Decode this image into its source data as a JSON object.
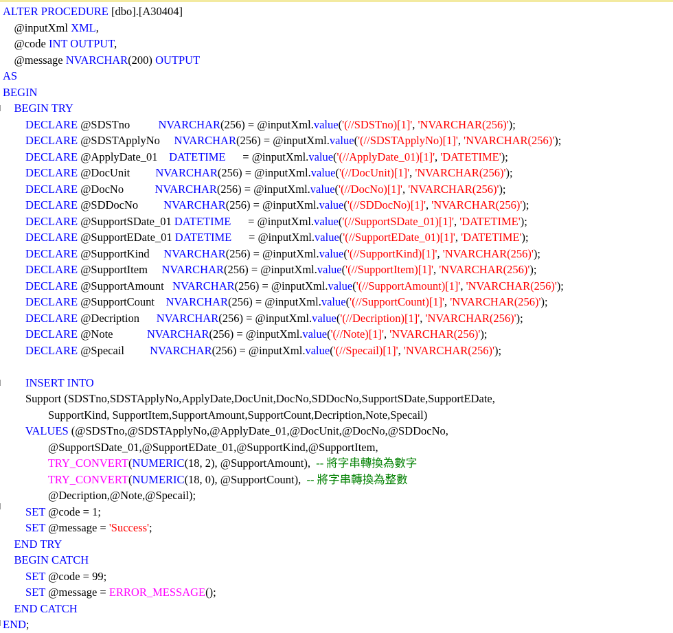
{
  "editor": {
    "lines": [
      [
        {
          "t": "ALTER PROCEDURE",
          "c": "kw"
        },
        {
          "t": " [dbo].[A30404]",
          "c": "pl"
        }
      ],
      [
        {
          "t": "    @inputXml ",
          "c": "pl"
        },
        {
          "t": "XML",
          "c": "kw"
        },
        {
          "t": ",",
          "c": "pl"
        }
      ],
      [
        {
          "t": "    @code ",
          "c": "pl"
        },
        {
          "t": "INT OUTPUT",
          "c": "kw"
        },
        {
          "t": ",",
          "c": "pl"
        }
      ],
      [
        {
          "t": "    @message ",
          "c": "pl"
        },
        {
          "t": "NVARCHAR",
          "c": "kw"
        },
        {
          "t": "(200) ",
          "c": "pl"
        },
        {
          "t": "OUTPUT",
          "c": "kw"
        }
      ],
      [
        {
          "t": "AS",
          "c": "kw"
        }
      ],
      [
        {
          "t": "BEGIN",
          "c": "kw"
        }
      ],
      [
        {
          "t": "    ",
          "c": "pl"
        },
        {
          "t": "BEGIN TRY",
          "c": "kw"
        }
      ],
      [
        {
          "t": "        ",
          "c": "pl"
        },
        {
          "t": "DECLARE",
          "c": "kw"
        },
        {
          "t": " @SDSTno          ",
          "c": "pl"
        },
        {
          "t": "NVARCHAR",
          "c": "kw"
        },
        {
          "t": "(256) = @inputXml.",
          "c": "pl"
        },
        {
          "t": "value",
          "c": "kw"
        },
        {
          "t": "(",
          "c": "pl"
        },
        {
          "t": "'(//SDSTno)[1]'",
          "c": "str"
        },
        {
          "t": ", ",
          "c": "pl"
        },
        {
          "t": "'NVARCHAR(256)'",
          "c": "str"
        },
        {
          "t": ");",
          "c": "pl"
        }
      ],
      [
        {
          "t": "        ",
          "c": "pl"
        },
        {
          "t": "DECLARE",
          "c": "kw"
        },
        {
          "t": " @SDSTApplyNo     ",
          "c": "pl"
        },
        {
          "t": "NVARCHAR",
          "c": "kw"
        },
        {
          "t": "(256) = @inputXml.",
          "c": "pl"
        },
        {
          "t": "value",
          "c": "kw"
        },
        {
          "t": "(",
          "c": "pl"
        },
        {
          "t": "'(//SDSTApplyNo)[1]'",
          "c": "str"
        },
        {
          "t": ", ",
          "c": "pl"
        },
        {
          "t": "'NVARCHAR(256)'",
          "c": "str"
        },
        {
          "t": ");",
          "c": "pl"
        }
      ],
      [
        {
          "t": "        ",
          "c": "pl"
        },
        {
          "t": "DECLARE",
          "c": "kw"
        },
        {
          "t": " @ApplyDate_01    ",
          "c": "pl"
        },
        {
          "t": "DATETIME",
          "c": "kw"
        },
        {
          "t": "      = @inputXml.",
          "c": "pl"
        },
        {
          "t": "value",
          "c": "kw"
        },
        {
          "t": "(",
          "c": "pl"
        },
        {
          "t": "'(//ApplyDate_01)[1]'",
          "c": "str"
        },
        {
          "t": ", ",
          "c": "pl"
        },
        {
          "t": "'DATETIME'",
          "c": "str"
        },
        {
          "t": ");",
          "c": "pl"
        }
      ],
      [
        {
          "t": "        ",
          "c": "pl"
        },
        {
          "t": "DECLARE",
          "c": "kw"
        },
        {
          "t": " @DocUnit         ",
          "c": "pl"
        },
        {
          "t": "NVARCHAR",
          "c": "kw"
        },
        {
          "t": "(256) = @inputXml.",
          "c": "pl"
        },
        {
          "t": "value",
          "c": "kw"
        },
        {
          "t": "(",
          "c": "pl"
        },
        {
          "t": "'(//DocUnit)[1]'",
          "c": "str"
        },
        {
          "t": ", ",
          "c": "pl"
        },
        {
          "t": "'NVARCHAR(256)'",
          "c": "str"
        },
        {
          "t": ");",
          "c": "pl"
        }
      ],
      [
        {
          "t": "        ",
          "c": "pl"
        },
        {
          "t": "DECLARE",
          "c": "kw"
        },
        {
          "t": " @DocNo           ",
          "c": "pl"
        },
        {
          "t": "NVARCHAR",
          "c": "kw"
        },
        {
          "t": "(256) = @inputXml.",
          "c": "pl"
        },
        {
          "t": "value",
          "c": "kw"
        },
        {
          "t": "(",
          "c": "pl"
        },
        {
          "t": "'(//DocNo)[1]'",
          "c": "str"
        },
        {
          "t": ", ",
          "c": "pl"
        },
        {
          "t": "'NVARCHAR(256)'",
          "c": "str"
        },
        {
          "t": ");",
          "c": "pl"
        }
      ],
      [
        {
          "t": "        ",
          "c": "pl"
        },
        {
          "t": "DECLARE",
          "c": "kw"
        },
        {
          "t": " @SDDocNo         ",
          "c": "pl"
        },
        {
          "t": "NVARCHAR",
          "c": "kw"
        },
        {
          "t": "(256) = @inputXml.",
          "c": "pl"
        },
        {
          "t": "value",
          "c": "kw"
        },
        {
          "t": "(",
          "c": "pl"
        },
        {
          "t": "'(//SDDocNo)[1]'",
          "c": "str"
        },
        {
          "t": ", ",
          "c": "pl"
        },
        {
          "t": "'NVARCHAR(256)'",
          "c": "str"
        },
        {
          "t": ");",
          "c": "pl"
        }
      ],
      [
        {
          "t": "        ",
          "c": "pl"
        },
        {
          "t": "DECLARE",
          "c": "kw"
        },
        {
          "t": " @SupportSDate_01 ",
          "c": "pl"
        },
        {
          "t": "DATETIME",
          "c": "kw"
        },
        {
          "t": "      = @inputXml.",
          "c": "pl"
        },
        {
          "t": "value",
          "c": "kw"
        },
        {
          "t": "(",
          "c": "pl"
        },
        {
          "t": "'(//SupportSDate_01)[1]'",
          "c": "str"
        },
        {
          "t": ", ",
          "c": "pl"
        },
        {
          "t": "'DATETIME'",
          "c": "str"
        },
        {
          "t": ");",
          "c": "pl"
        }
      ],
      [
        {
          "t": "        ",
          "c": "pl"
        },
        {
          "t": "DECLARE",
          "c": "kw"
        },
        {
          "t": " @SupportEDate_01 ",
          "c": "pl"
        },
        {
          "t": "DATETIME",
          "c": "kw"
        },
        {
          "t": "      = @inputXml.",
          "c": "pl"
        },
        {
          "t": "value",
          "c": "kw"
        },
        {
          "t": "(",
          "c": "pl"
        },
        {
          "t": "'(//SupportEDate_01)[1]'",
          "c": "str"
        },
        {
          "t": ", ",
          "c": "pl"
        },
        {
          "t": "'DATETIME'",
          "c": "str"
        },
        {
          "t": ");",
          "c": "pl"
        }
      ],
      [
        {
          "t": "        ",
          "c": "pl"
        },
        {
          "t": "DECLARE",
          "c": "kw"
        },
        {
          "t": " @SupportKind     ",
          "c": "pl"
        },
        {
          "t": "NVARCHAR",
          "c": "kw"
        },
        {
          "t": "(256) = @inputXml.",
          "c": "pl"
        },
        {
          "t": "value",
          "c": "kw"
        },
        {
          "t": "(",
          "c": "pl"
        },
        {
          "t": "'(//SupportKind)[1]'",
          "c": "str"
        },
        {
          "t": ", ",
          "c": "pl"
        },
        {
          "t": "'NVARCHAR(256)'",
          "c": "str"
        },
        {
          "t": ");",
          "c": "pl"
        }
      ],
      [
        {
          "t": "        ",
          "c": "pl"
        },
        {
          "t": "DECLARE",
          "c": "kw"
        },
        {
          "t": " @SupportItem     ",
          "c": "pl"
        },
        {
          "t": "NVARCHAR",
          "c": "kw"
        },
        {
          "t": "(256) = @inputXml.",
          "c": "pl"
        },
        {
          "t": "value",
          "c": "kw"
        },
        {
          "t": "(",
          "c": "pl"
        },
        {
          "t": "'(//SupportItem)[1]'",
          "c": "str"
        },
        {
          "t": ", ",
          "c": "pl"
        },
        {
          "t": "'NVARCHAR(256)'",
          "c": "str"
        },
        {
          "t": ");",
          "c": "pl"
        }
      ],
      [
        {
          "t": "        ",
          "c": "pl"
        },
        {
          "t": "DECLARE",
          "c": "kw"
        },
        {
          "t": " @SupportAmount   ",
          "c": "pl"
        },
        {
          "t": "NVARCHAR",
          "c": "kw"
        },
        {
          "t": "(256) = @inputXml.",
          "c": "pl"
        },
        {
          "t": "value",
          "c": "kw"
        },
        {
          "t": "(",
          "c": "pl"
        },
        {
          "t": "'(//SupportAmount)[1]'",
          "c": "str"
        },
        {
          "t": ", ",
          "c": "pl"
        },
        {
          "t": "'NVARCHAR(256)'",
          "c": "str"
        },
        {
          "t": ");",
          "c": "pl"
        }
      ],
      [
        {
          "t": "        ",
          "c": "pl"
        },
        {
          "t": "DECLARE",
          "c": "kw"
        },
        {
          "t": " @SupportCount    ",
          "c": "pl"
        },
        {
          "t": "NVARCHAR",
          "c": "kw"
        },
        {
          "t": "(256) = @inputXml.",
          "c": "pl"
        },
        {
          "t": "value",
          "c": "kw"
        },
        {
          "t": "(",
          "c": "pl"
        },
        {
          "t": "'(//SupportCount)[1]'",
          "c": "str"
        },
        {
          "t": ", ",
          "c": "pl"
        },
        {
          "t": "'NVARCHAR(256)'",
          "c": "str"
        },
        {
          "t": ");",
          "c": "pl"
        }
      ],
      [
        {
          "t": "        ",
          "c": "pl"
        },
        {
          "t": "DECLARE",
          "c": "kw"
        },
        {
          "t": " @Decription      ",
          "c": "pl"
        },
        {
          "t": "NVARCHAR",
          "c": "kw"
        },
        {
          "t": "(256) = @inputXml.",
          "c": "pl"
        },
        {
          "t": "value",
          "c": "kw"
        },
        {
          "t": "(",
          "c": "pl"
        },
        {
          "t": "'(//Decription)[1]'",
          "c": "str"
        },
        {
          "t": ", ",
          "c": "pl"
        },
        {
          "t": "'NVARCHAR(256)'",
          "c": "str"
        },
        {
          "t": ");",
          "c": "pl"
        }
      ],
      [
        {
          "t": "        ",
          "c": "pl"
        },
        {
          "t": "DECLARE",
          "c": "kw"
        },
        {
          "t": " @Note            ",
          "c": "pl"
        },
        {
          "t": "NVARCHAR",
          "c": "kw"
        },
        {
          "t": "(256) = @inputXml.",
          "c": "pl"
        },
        {
          "t": "value",
          "c": "kw"
        },
        {
          "t": "(",
          "c": "pl"
        },
        {
          "t": "'(//Note)[1]'",
          "c": "str"
        },
        {
          "t": ", ",
          "c": "pl"
        },
        {
          "t": "'NVARCHAR(256)'",
          "c": "str"
        },
        {
          "t": ");",
          "c": "pl"
        }
      ],
      [
        {
          "t": "        ",
          "c": "pl"
        },
        {
          "t": "DECLARE",
          "c": "kw"
        },
        {
          "t": " @Specail         ",
          "c": "pl"
        },
        {
          "t": "NVARCHAR",
          "c": "kw"
        },
        {
          "t": "(256) = @inputXml.",
          "c": "pl"
        },
        {
          "t": "value",
          "c": "kw"
        },
        {
          "t": "(",
          "c": "pl"
        },
        {
          "t": "'(//Specail)[1]'",
          "c": "str"
        },
        {
          "t": ", ",
          "c": "pl"
        },
        {
          "t": "'NVARCHAR(256)'",
          "c": "str"
        },
        {
          "t": ");",
          "c": "pl"
        }
      ],
      [],
      [
        {
          "t": "        ",
          "c": "pl"
        },
        {
          "t": "INSERT INTO",
          "c": "kw"
        }
      ],
      [
        {
          "t": "        Support (SDSTno,SDSTApplyNo,ApplyDate,DocUnit,DocNo,SDDocNo,SupportSDate,SupportEDate,",
          "c": "pl"
        }
      ],
      [
        {
          "t": "                SupportKind, SupportItem,SupportAmount,SupportCount,Decription,Note,Specail)",
          "c": "pl"
        }
      ],
      [
        {
          "t": "        ",
          "c": "pl"
        },
        {
          "t": "VALUES",
          "c": "kw"
        },
        {
          "t": " (@SDSTno,@SDSTApplyNo,@ApplyDate_01,@DocUnit,@DocNo,@SDDocNo,",
          "c": "pl"
        }
      ],
      [
        {
          "t": "                @SupportSDate_01,@SupportEDate_01,@SupportKind,@SupportItem,",
          "c": "pl"
        }
      ],
      [
        {
          "t": "                ",
          "c": "pl"
        },
        {
          "t": "TRY_CONVERT",
          "c": "fn"
        },
        {
          "t": "(",
          "c": "pl"
        },
        {
          "t": "NUMERIC",
          "c": "kw"
        },
        {
          "t": "(18, 2), @SupportAmount),  ",
          "c": "pl"
        },
        {
          "t": "-- 將字串轉換為數字",
          "c": "cm"
        }
      ],
      [
        {
          "t": "                ",
          "c": "pl"
        },
        {
          "t": "TRY_CONVERT",
          "c": "fn"
        },
        {
          "t": "(",
          "c": "pl"
        },
        {
          "t": "NUMERIC",
          "c": "kw"
        },
        {
          "t": "(18, 0), @SupportCount),  ",
          "c": "pl"
        },
        {
          "t": "-- 將字串轉換為整數",
          "c": "cm"
        }
      ],
      [
        {
          "t": "                @Decription,@Note,@Specail);",
          "c": "pl"
        }
      ],
      [
        {
          "t": "        ",
          "c": "pl"
        },
        {
          "t": "SET",
          "c": "kw"
        },
        {
          "t": " @code = 1;",
          "c": "pl"
        }
      ],
      [
        {
          "t": "        ",
          "c": "pl"
        },
        {
          "t": "SET",
          "c": "kw"
        },
        {
          "t": " @message = ",
          "c": "pl"
        },
        {
          "t": "'Success'",
          "c": "str"
        },
        {
          "t": ";",
          "c": "pl"
        }
      ],
      [
        {
          "t": "    ",
          "c": "pl"
        },
        {
          "t": "END TRY",
          "c": "kw"
        }
      ],
      [
        {
          "t": "    ",
          "c": "pl"
        },
        {
          "t": "BEGIN CATCH",
          "c": "kw"
        }
      ],
      [
        {
          "t": "        ",
          "c": "pl"
        },
        {
          "t": "SET",
          "c": "kw"
        },
        {
          "t": " @code = 99;",
          "c": "pl"
        }
      ],
      [
        {
          "t": "        ",
          "c": "pl"
        },
        {
          "t": "SET",
          "c": "kw"
        },
        {
          "t": " @message = ",
          "c": "pl"
        },
        {
          "t": "ERROR_MESSAGE",
          "c": "fn"
        },
        {
          "t": "();",
          "c": "pl"
        }
      ],
      [
        {
          "t": "    ",
          "c": "pl"
        },
        {
          "t": "END CATCH",
          "c": "kw"
        }
      ],
      [
        {
          "t": "END",
          "c": "kw"
        },
        {
          "t": ";",
          "c": "pl"
        }
      ]
    ]
  }
}
